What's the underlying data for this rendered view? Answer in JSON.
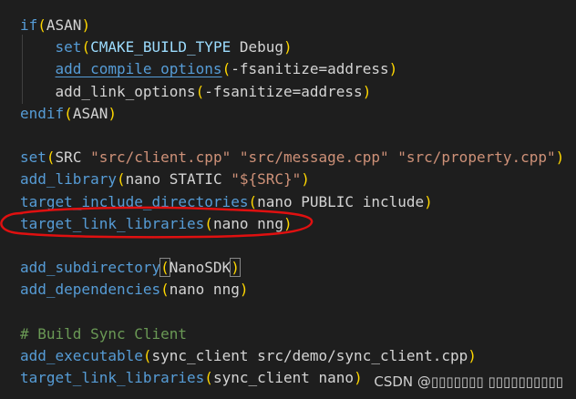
{
  "colors": {
    "background": "#1e1e1e",
    "keyword": "#569cd6",
    "function": "#dcdcaa",
    "string": "#ce9178",
    "variable": "#9cdcfe",
    "comment": "#6a9955",
    "text": "#d4d4d4",
    "annotation": "#e01010"
  },
  "code_lines": [
    [
      {
        "t": "if",
        "c": "kw"
      },
      {
        "t": "(",
        "c": "p1"
      },
      {
        "t": "ASAN",
        "c": "txt"
      },
      {
        "t": ")",
        "c": "p1"
      }
    ],
    [
      {
        "t": "    ",
        "c": "txt"
      },
      {
        "t": "set",
        "c": "kw"
      },
      {
        "t": "(",
        "c": "p1"
      },
      {
        "t": "CMAKE_BUILD_TYPE",
        "c": "var"
      },
      {
        "t": " Debug",
        "c": "txt"
      },
      {
        "t": ")",
        "c": "p1"
      }
    ],
    [
      {
        "t": "    ",
        "c": "txt"
      },
      {
        "t": "add_compile_options",
        "c": "kw",
        "u": true
      },
      {
        "t": "(",
        "c": "p1"
      },
      {
        "t": "-fsanitize=address",
        "c": "txt"
      },
      {
        "t": ")",
        "c": "p1"
      }
    ],
    [
      {
        "t": "    add_link_options",
        "c": "txt"
      },
      {
        "t": "(",
        "c": "p1"
      },
      {
        "t": "-fsanitize=address",
        "c": "txt"
      },
      {
        "t": ")",
        "c": "p1"
      }
    ],
    [
      {
        "t": "endif",
        "c": "kw"
      },
      {
        "t": "(",
        "c": "p1"
      },
      {
        "t": "ASAN",
        "c": "txt"
      },
      {
        "t": ")",
        "c": "p1"
      }
    ],
    [],
    [
      {
        "t": "set",
        "c": "kw"
      },
      {
        "t": "(",
        "c": "p1"
      },
      {
        "t": "SRC ",
        "c": "txt"
      },
      {
        "t": "\"src/client.cpp\"",
        "c": "str"
      },
      {
        "t": " ",
        "c": "txt"
      },
      {
        "t": "\"src/message.cpp\"",
        "c": "str"
      },
      {
        "t": " ",
        "c": "txt"
      },
      {
        "t": "\"src/property.cpp\"",
        "c": "str"
      },
      {
        "t": ")",
        "c": "p1"
      }
    ],
    [
      {
        "t": "add_library",
        "c": "kw"
      },
      {
        "t": "(",
        "c": "p1"
      },
      {
        "t": "nano STATIC ",
        "c": "txt"
      },
      {
        "t": "\"${SRC}\"",
        "c": "str"
      },
      {
        "t": ")",
        "c": "p1"
      }
    ],
    [
      {
        "t": "target_include_directories",
        "c": "kw"
      },
      {
        "t": "(",
        "c": "p1"
      },
      {
        "t": "nano PUBLIC include",
        "c": "txt"
      },
      {
        "t": ")",
        "c": "p1"
      }
    ],
    [
      {
        "t": "target_link_libraries",
        "c": "kw"
      },
      {
        "t": "(",
        "c": "p1"
      },
      {
        "t": "nano nng",
        "c": "txt"
      },
      {
        "t": ")",
        "c": "p1"
      }
    ],
    [],
    [
      {
        "t": "add_subdirectory",
        "c": "kw"
      },
      {
        "t": "(",
        "c": "p1",
        "b": true
      },
      {
        "t": "NanoSDK",
        "c": "txt"
      },
      {
        "t": ")",
        "c": "p1",
        "b": true
      }
    ],
    [
      {
        "t": "add_dependencies",
        "c": "kw"
      },
      {
        "t": "(",
        "c": "p1"
      },
      {
        "t": "nano nng",
        "c": "txt"
      },
      {
        "t": ")",
        "c": "p1"
      }
    ],
    [],
    [
      {
        "t": "# Build Sync Client",
        "c": "cm"
      }
    ],
    [
      {
        "t": "add_executable",
        "c": "kw"
      },
      {
        "t": "(",
        "c": "p1"
      },
      {
        "t": "sync_client src/demo/sync_client.cpp",
        "c": "txt"
      },
      {
        "t": ")",
        "c": "p1"
      }
    ],
    [
      {
        "t": "target_link_libraries",
        "c": "kw"
      },
      {
        "t": "(",
        "c": "p1"
      },
      {
        "t": "sync_client nano",
        "c": "txt"
      },
      {
        "t": ")",
        "c": "p1"
      }
    ]
  ],
  "watermark": "CSDN @▯▯▯▯▯▯▯ ▯▯▯▯▯▯▯▯▯▯"
}
